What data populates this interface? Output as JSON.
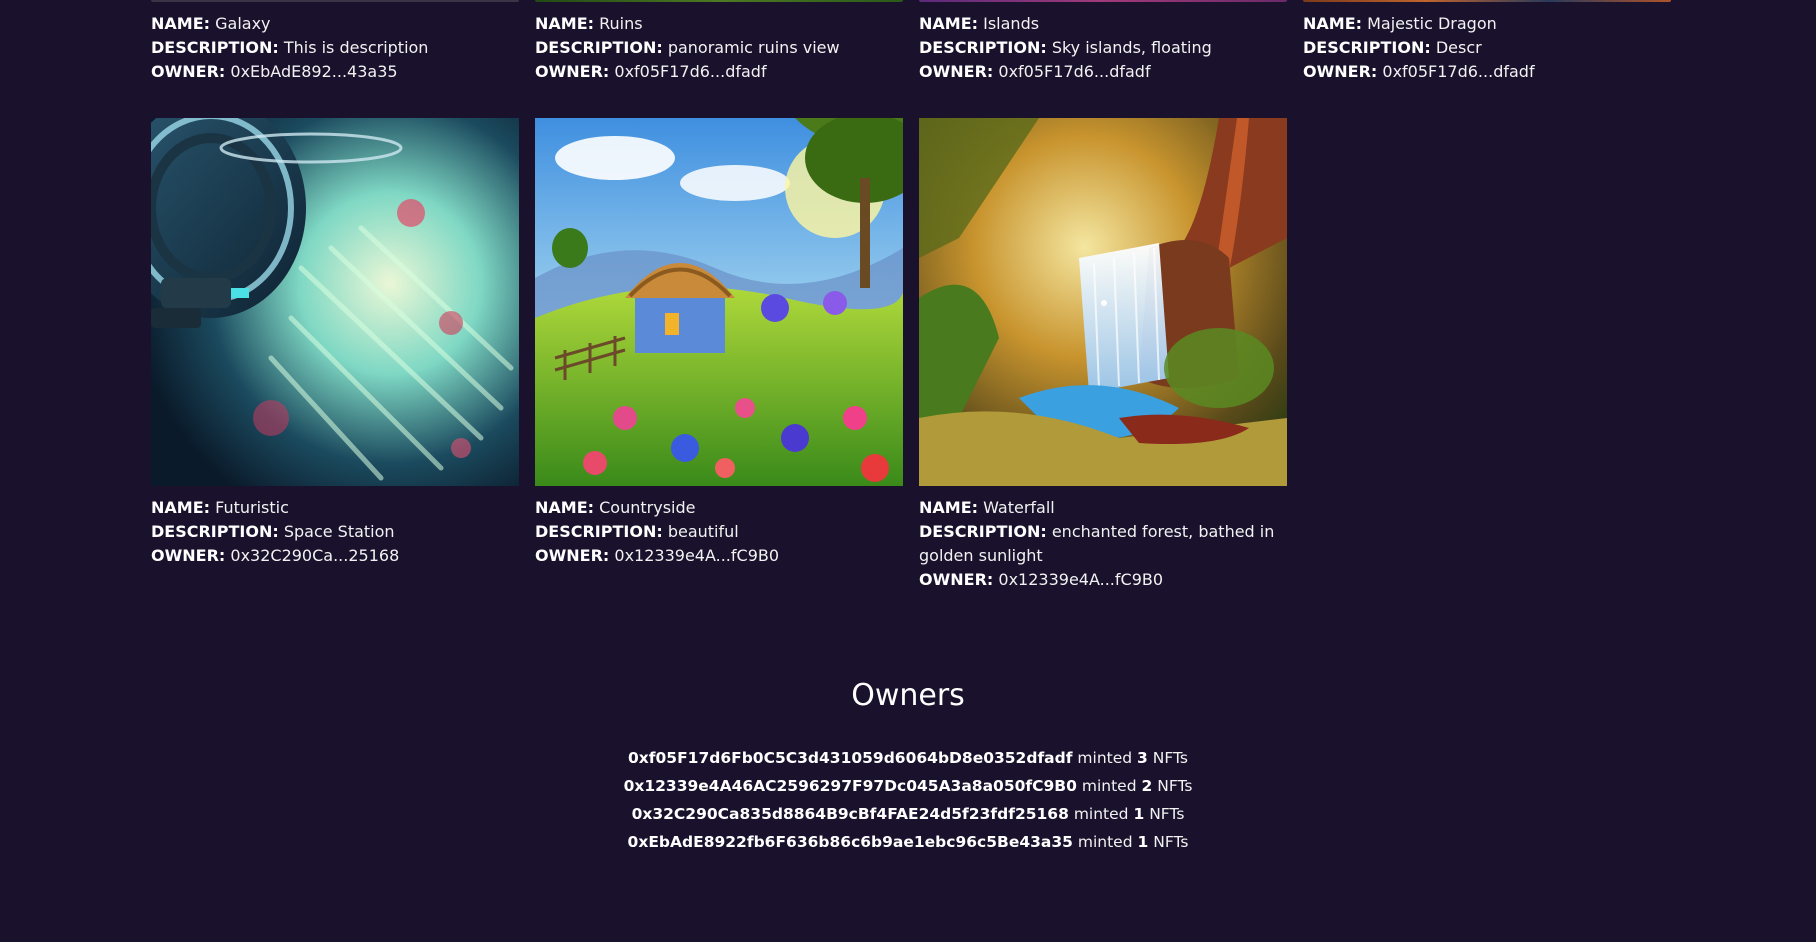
{
  "nfts_top": [
    {
      "name": "Galaxy",
      "description": "This is description",
      "owner": "0xEbAdE892...43a35",
      "strip_color": "#3b3346"
    },
    {
      "name": "Ruins",
      "description": "panoramic ruins view",
      "owner": "0xf05F17d6...dfadf",
      "strip_color": "#2f5a1e"
    },
    {
      "name": "Islands",
      "description": "Sky islands, floating",
      "owner": "0xf05F17d6...dfadf",
      "strip_color": "#8a2c6a"
    },
    {
      "name": "Majestic Dragon",
      "description": "Descr",
      "owner": "0xf05F17d6...dfadf",
      "strip_color": "#b0532b"
    }
  ],
  "nfts": [
    {
      "name": "Futuristic",
      "description": "Space Station",
      "owner": "0x32C290Ca...25168",
      "image": "space-station"
    },
    {
      "name": "Countryside",
      "description": "beautiful",
      "owner": "0x12339e4A...fC9B0",
      "image": "countryside-cottage"
    },
    {
      "name": "Waterfall",
      "description": "enchanted forest, bathed in golden sunlight",
      "owner": "0x12339e4A...fC9B0",
      "image": "forest-waterfall"
    }
  ],
  "labels": {
    "name": "NAME:",
    "description": "DESCRIPTION:",
    "owner": "OWNER:"
  },
  "owners": {
    "title": "Owners",
    "minted_word": "minted",
    "unit": "NFTs",
    "list": [
      {
        "address": "0xf05F17d6Fb0C5C3d431059d6064bD8e0352dfadf",
        "count": "3"
      },
      {
        "address": "0x12339e4A46AC2596297F97Dc045A3a8a050fC9B0",
        "count": "2"
      },
      {
        "address": "0x32C290Ca835d8864B9cBf4FAE24d5f23fdf25168",
        "count": "1"
      },
      {
        "address": "0xEbAdE8922fb6F636b86c6b9ae1ebc96c5Be43a35",
        "count": "1"
      }
    ]
  },
  "colors": {
    "background": "#1a112c",
    "text": "#ffffff"
  }
}
